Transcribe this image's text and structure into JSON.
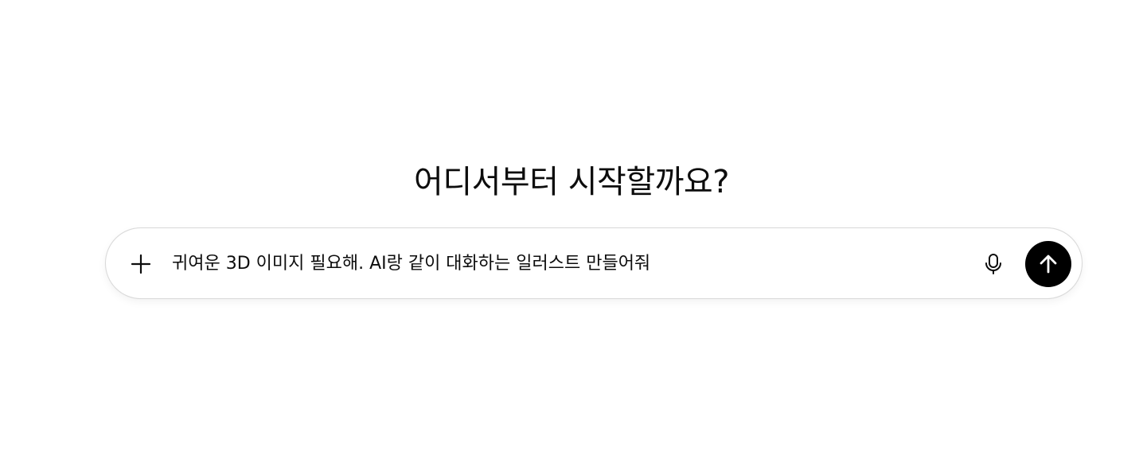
{
  "main": {
    "heading": "어디서부터 시작할까요?"
  },
  "composer": {
    "input_value": "귀여운 3D 이미지 필요해. AI랑 같이 대화하는 일러스트 만들어줘",
    "icons": {
      "add": "plus-icon",
      "voice": "microphone-icon",
      "send": "arrow-up-icon"
    }
  },
  "colors": {
    "text": "#0d0d0d",
    "border": "#d9d9d9",
    "send_button_bg": "#000000",
    "send_icon": "#ffffff"
  }
}
